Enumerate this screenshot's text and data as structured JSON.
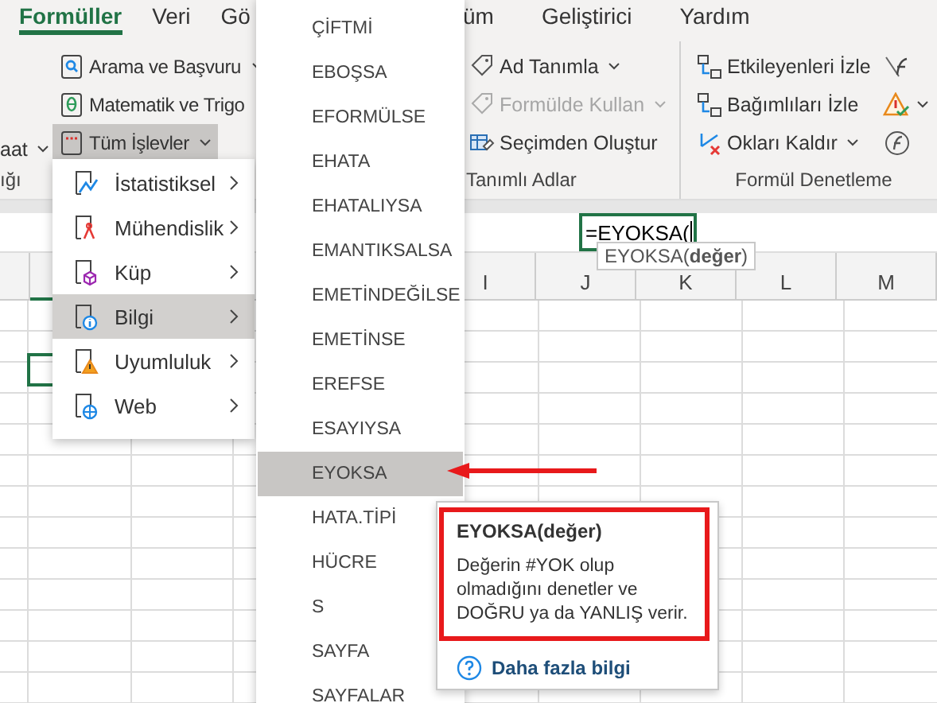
{
  "tabs": [
    {
      "label": "Formüller",
      "selected": true
    },
    {
      "label": "Veri",
      "selected": false
    },
    {
      "label": "Gö",
      "selected": false
    },
    {
      "label": "üm",
      "selected": false
    },
    {
      "label": "Geliştirici",
      "selected": false
    },
    {
      "label": "Yardım",
      "selected": false
    }
  ],
  "ribbon": {
    "groups": [
      {
        "label": "ığı",
        "buttons": [
          {
            "label": "aat",
            "kind": "plain",
            "dropdown": true,
            "selected": false,
            "disabled": false
          }
        ]
      },
      {
        "buttons": [
          {
            "label": "Arama ve Başvuru",
            "kind": "lookup",
            "dropdown": true,
            "selected": false,
            "disabled": false
          },
          {
            "label": "Matematik ve Trigo",
            "kind": "math",
            "dropdown": false,
            "selected": false,
            "disabled": false
          },
          {
            "label": "Tüm İşlevler",
            "kind": "all",
            "dropdown": true,
            "selected": true,
            "disabled": false
          }
        ]
      },
      {
        "label": "Tanımlı Adlar",
        "buttons": [
          {
            "label": "Ad Tanımla",
            "kind": "tag",
            "dropdown": true,
            "selected": false,
            "disabled": false
          },
          {
            "label": "Formülde Kullan",
            "kind": "use",
            "dropdown": true,
            "selected": false,
            "disabled": true
          },
          {
            "label": "Seçimden Oluştur",
            "kind": "create",
            "dropdown": false,
            "selected": false,
            "disabled": false
          }
        ]
      },
      {
        "label": "Formül Denetleme",
        "buttons": [
          {
            "label": "Etkileyenleri İzle",
            "kind": "precedents",
            "dropdown": false,
            "selected": false,
            "disabled": false
          },
          {
            "label": "Bağımlıları İzle",
            "kind": "dependents",
            "dropdown": false,
            "selected": false,
            "disabled": false
          },
          {
            "label": "Okları Kaldır",
            "kind": "remove",
            "dropdown": true,
            "selected": false,
            "disabled": false
          }
        ],
        "side_buttons": [
          {
            "kind": "show",
            "dropdown": false
          },
          {
            "kind": "error",
            "dropdown": true
          },
          {
            "kind": "evaluate",
            "dropdown": false
          }
        ]
      }
    ]
  },
  "cell_editor": {
    "value": "=EYOKSA("
  },
  "edit_hint": "EYOKSA(**değer**)",
  "columns": [
    "I",
    "J",
    "K",
    "L",
    "M"
  ],
  "category_menu": [
    {
      "label": "İstatistiksel",
      "kind": "stats",
      "selected": false
    },
    {
      "label": "Mühendislik",
      "kind": "engineering",
      "selected": false
    },
    {
      "label": "Küp",
      "kind": "cube",
      "selected": false
    },
    {
      "label": "Bilgi",
      "kind": "info",
      "selected": true
    },
    {
      "label": "Uyumluluk",
      "kind": "compat",
      "selected": false
    },
    {
      "label": "Web",
      "kind": "web",
      "selected": false
    }
  ],
  "function_menu": [
    {
      "label": "ÇİFTMİ",
      "selected": false
    },
    {
      "label": "EBOŞSA",
      "selected": false
    },
    {
      "label": "EFORMÜLSE",
      "selected": false
    },
    {
      "label": "EHATA",
      "selected": false
    },
    {
      "label": "EHATALIYSA",
      "selected": false
    },
    {
      "label": "EMANTIKSALSA",
      "selected": false
    },
    {
      "label": "EMETİNDEĞİLSE",
      "selected": false
    },
    {
      "label": "EMETİNSE",
      "selected": false
    },
    {
      "label": "EREFSE",
      "selected": false
    },
    {
      "label": "ESAYIYSA",
      "selected": false
    },
    {
      "label": "EYOKSA",
      "selected": true
    },
    {
      "label": "HATA.TİPİ",
      "selected": false
    },
    {
      "label": "HÜCRE",
      "selected": false
    },
    {
      "label": "S",
      "selected": false
    },
    {
      "label": "SAYFA",
      "selected": false
    },
    {
      "label": "SAYFALAR",
      "selected": false
    }
  ],
  "function_tip": {
    "title": "EYOKSA(değer)",
    "description": "Değerin #YOK olup olmadığını denetler ve DOĞRU ya da YANLIŞ verir.",
    "link": "Daha fazla bilgi"
  }
}
